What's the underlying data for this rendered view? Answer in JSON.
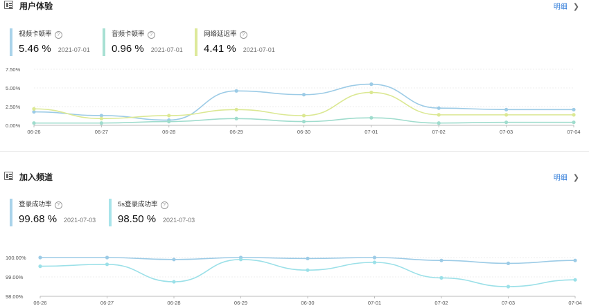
{
  "sections": [
    {
      "title": "用户体验",
      "detail_label": "明细",
      "metrics": [
        {
          "name": "视频卡顿率",
          "value": "5.46 %",
          "date": "2021-07-01",
          "color": "#a9d3ea"
        },
        {
          "name": "音频卡顿率",
          "value": "0.96 %",
          "date": "2021-07-01",
          "color": "#a8e0d3"
        },
        {
          "name": "网络延迟率",
          "value": "4.41 %",
          "date": "2021-07-01",
          "color": "#dde99a"
        }
      ]
    },
    {
      "title": "加入频道",
      "detail_label": "明细",
      "metrics": [
        {
          "name": "登录成功率",
          "value": "99.68 %",
          "date": "2021-07-03",
          "color": "#a9d3ea"
        },
        {
          "name": "5s登录成功率",
          "value": "98.50 %",
          "date": "2021-07-03",
          "color": "#a8e4ea"
        }
      ]
    }
  ],
  "chart_data": [
    {
      "type": "line",
      "categories": [
        "06-26",
        "06-27",
        "06-28",
        "06-29",
        "06-30",
        "07-01",
        "07-02",
        "07-03",
        "07-04"
      ],
      "y_ticks": [
        "0.00%",
        "2.50%",
        "5.00%",
        "7.50%"
      ],
      "ylim": [
        0,
        7.5
      ],
      "grid": true,
      "series": [
        {
          "name": "视频卡顿率",
          "color": "#9ccbe6",
          "values": [
            1.8,
            1.3,
            0.7,
            4.6,
            4.1,
            5.5,
            2.3,
            2.1,
            2.1
          ]
        },
        {
          "name": "音频卡顿率",
          "color": "#9fdccd",
          "values": [
            0.3,
            0.3,
            0.5,
            0.9,
            0.5,
            1.0,
            0.3,
            0.4,
            0.4
          ]
        },
        {
          "name": "网络延迟率",
          "color": "#dbe893",
          "values": [
            2.2,
            0.9,
            1.3,
            2.1,
            1.3,
            4.4,
            1.4,
            1.4,
            1.4
          ]
        }
      ]
    },
    {
      "type": "line",
      "categories": [
        "06-26",
        "06-27",
        "06-28",
        "06-29",
        "06-30",
        "07-01",
        "07-02",
        "07-03",
        "07-04"
      ],
      "y_ticks": [
        "98.00%",
        "99.00%",
        "100.00%"
      ],
      "ylim": [
        98,
        100
      ],
      "grid": true,
      "series": [
        {
          "name": "登录成功率",
          "color": "#9ccbe6",
          "values": [
            100.0,
            100.0,
            99.9,
            100.0,
            99.95,
            100.0,
            99.85,
            99.7,
            99.85
          ]
        },
        {
          "name": "5s登录成功率",
          "color": "#9be0e8",
          "values": [
            99.55,
            99.65,
            98.75,
            99.9,
            99.35,
            99.75,
            98.95,
            98.5,
            98.85
          ]
        }
      ]
    }
  ]
}
